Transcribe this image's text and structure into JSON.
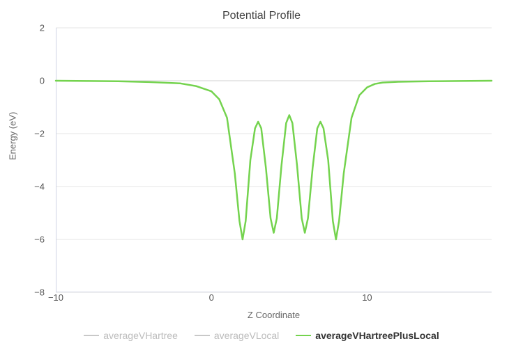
{
  "chart_data": {
    "type": "line",
    "title": "Potential Profile",
    "xlabel": "Z Coordinate",
    "ylabel": "Energy (eV)",
    "xlim": [
      -10,
      18
    ],
    "ylim": [
      -8,
      2
    ],
    "x_ticks": [
      -10,
      0,
      10
    ],
    "y_ticks": [
      -8,
      -6,
      -4,
      -2,
      0,
      2
    ],
    "legend_position": "bottom",
    "grid": "horizontal",
    "series": [
      {
        "name": "averageVHartree",
        "visible": false,
        "color": "#bdbdbd",
        "x": [],
        "values": []
      },
      {
        "name": "averageVLocal",
        "visible": false,
        "color": "#bdbdbd",
        "x": [],
        "values": []
      },
      {
        "name": "averageVHartreePlusLocal",
        "visible": true,
        "color": "#74d34e",
        "x": [
          -10.0,
          -8.0,
          -6.0,
          -4.0,
          -2.0,
          -1.0,
          0.0,
          0.5,
          1.0,
          1.5,
          1.8,
          2.0,
          2.2,
          2.5,
          2.8,
          3.0,
          3.2,
          3.5,
          3.8,
          4.0,
          4.2,
          4.5,
          4.8,
          5.0,
          5.2,
          5.5,
          5.8,
          6.0,
          6.2,
          6.5,
          6.8,
          7.0,
          7.2,
          7.5,
          7.8,
          8.0,
          8.2,
          8.5,
          9.0,
          9.5,
          10.0,
          10.5,
          11.0,
          12.0,
          14.0,
          16.0,
          18.0
        ],
        "values": [
          0.0,
          -0.01,
          -0.02,
          -0.05,
          -0.1,
          -0.2,
          -0.4,
          -0.7,
          -1.4,
          -3.5,
          -5.3,
          -6.0,
          -5.3,
          -3.0,
          -1.8,
          -1.55,
          -1.8,
          -3.3,
          -5.2,
          -5.75,
          -5.2,
          -3.2,
          -1.6,
          -1.3,
          -1.6,
          -3.2,
          -5.2,
          -5.75,
          -5.2,
          -3.3,
          -1.8,
          -1.55,
          -1.8,
          -3.0,
          -5.3,
          -6.0,
          -5.3,
          -3.5,
          -1.4,
          -0.55,
          -0.25,
          -0.12,
          -0.07,
          -0.04,
          -0.02,
          -0.01,
          0.0
        ]
      }
    ]
  }
}
